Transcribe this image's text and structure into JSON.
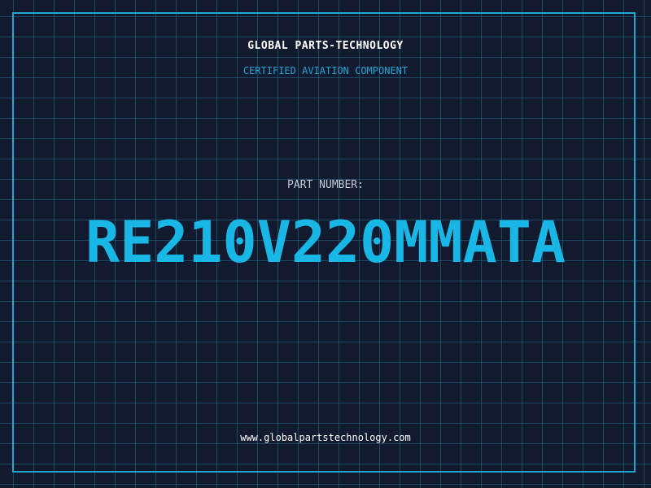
{
  "header": {
    "brand": "GLOBAL PARTS-TECHNOLOGY",
    "tagline": "CERTIFIED AVIATION COMPONENT"
  },
  "part": {
    "label": "PART NUMBER:",
    "number": "RE210V220MMATA"
  },
  "footer": {
    "website": "www.globalpartstechnology.com"
  },
  "colors": {
    "background": "#111a2e",
    "grid": "#246e8c",
    "accent": "#18b7e6",
    "text": "#ffffff"
  }
}
